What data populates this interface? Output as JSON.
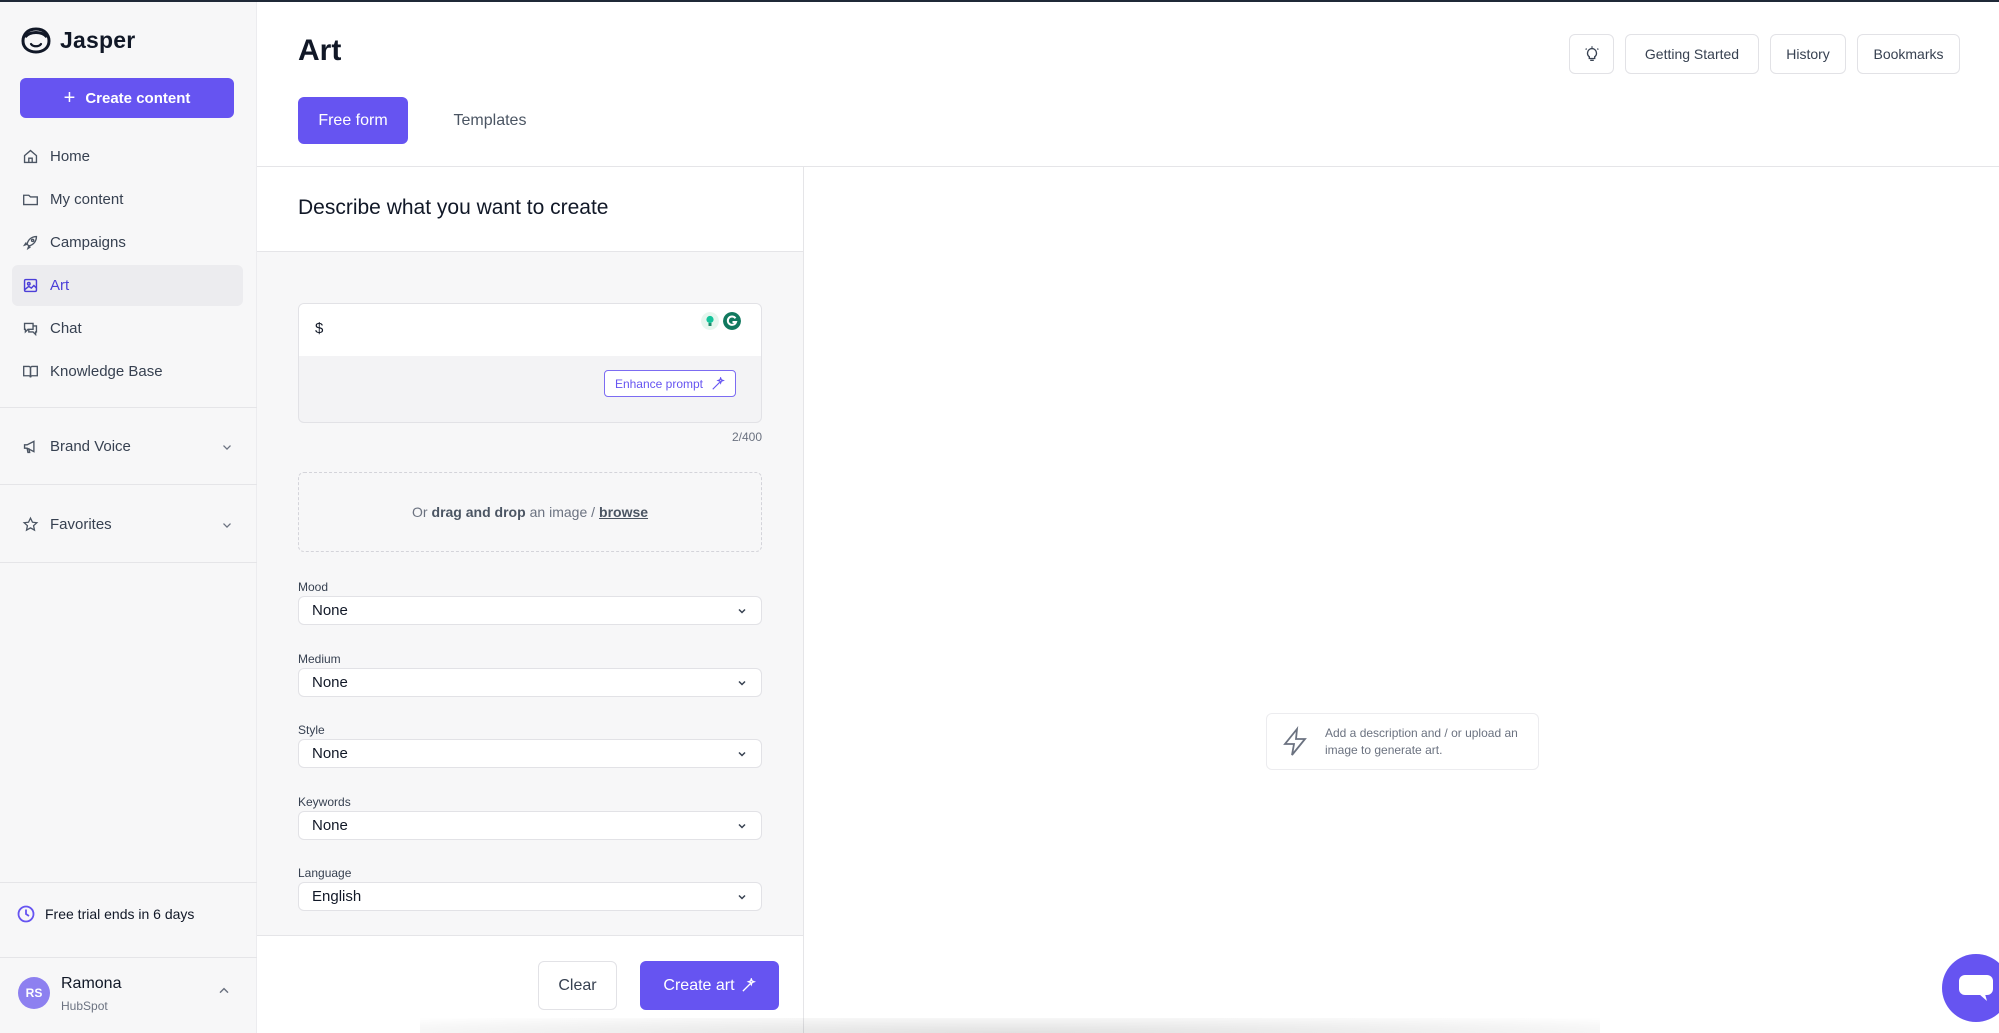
{
  "app": {
    "name": "Jasper",
    "brand_color": "#6654f1"
  },
  "sidebar": {
    "create_label": "Create content",
    "items": [
      {
        "label": "Home",
        "icon": "home-icon"
      },
      {
        "label": "My content",
        "icon": "folder-icon"
      },
      {
        "label": "Campaigns",
        "icon": "rocket-icon"
      },
      {
        "label": "Art",
        "icon": "image-icon",
        "active": true
      },
      {
        "label": "Chat",
        "icon": "chat-icon"
      },
      {
        "label": "Knowledge Base",
        "icon": "book-icon"
      }
    ],
    "sections": [
      {
        "label": "Brand Voice",
        "icon": "megaphone-icon"
      },
      {
        "label": "Favorites",
        "icon": "star-icon"
      }
    ],
    "trial_text": "Free trial ends in 6 days",
    "user": {
      "initials": "RS",
      "name": "Ramona",
      "org": "HubSpot"
    }
  },
  "header": {
    "title": "Art",
    "tabs": [
      {
        "label": "Free form",
        "active": true
      },
      {
        "label": "Templates",
        "active": false
      }
    ],
    "buttons": {
      "tips_icon": "lightbulb-icon",
      "getting_started": "Getting Started",
      "history": "History",
      "bookmarks": "Bookmarks"
    }
  },
  "form": {
    "heading": "Describe what you want to create",
    "prompt_value": "$",
    "enhance_label": "Enhance prompt",
    "counter": "2/400",
    "drop": {
      "prefix": "Or",
      "bold": "drag and drop",
      "middle": "an image /",
      "link": "browse"
    },
    "fields": [
      {
        "label": "Mood",
        "value": "None"
      },
      {
        "label": "Medium",
        "value": "None"
      },
      {
        "label": "Style",
        "value": "None"
      },
      {
        "label": "Keywords",
        "value": "None"
      },
      {
        "label": "Language",
        "value": "English"
      }
    ],
    "clear_label": "Clear",
    "create_label": "Create art"
  },
  "canvas": {
    "hint": "Add a description and / or upload an image to generate art."
  }
}
